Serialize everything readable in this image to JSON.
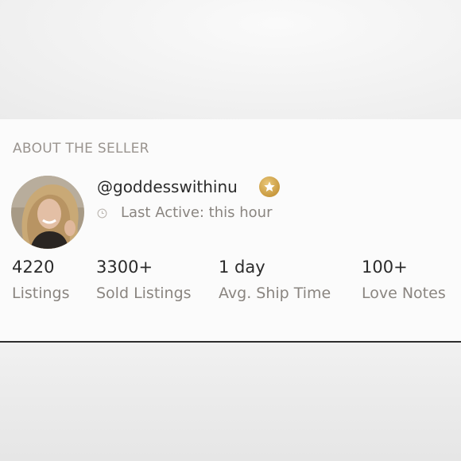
{
  "section": {
    "title": "ABOUT THE SELLER"
  },
  "seller": {
    "username": "@goddesswithinu",
    "badge_icon": "star-icon",
    "badge_color": "#c99a3f",
    "last_active": "Last Active: this hour"
  },
  "stats": [
    {
      "value": "4220",
      "label": "Listings"
    },
    {
      "value": "3300+",
      "label": "Sold Listings"
    },
    {
      "value": "1 day",
      "label": "Avg. Ship Time"
    },
    {
      "value": "100+",
      "label": "Love Notes"
    }
  ]
}
